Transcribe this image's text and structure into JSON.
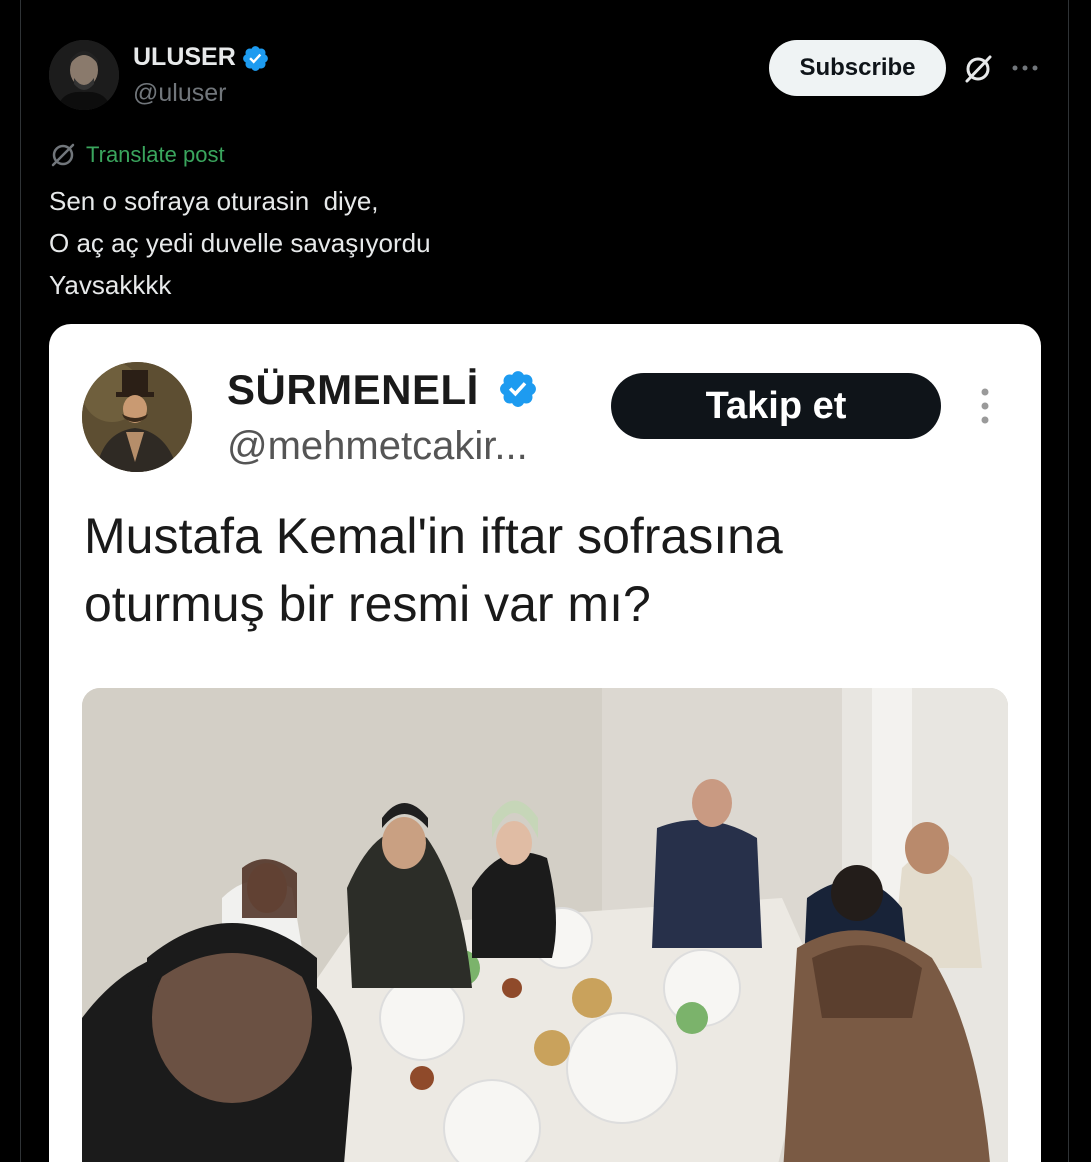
{
  "author": {
    "display_name": "ULUSER",
    "handle": "@uluser",
    "verified": true,
    "verified_color": "#1d9bf0"
  },
  "actions": {
    "subscribe_label": "Subscribe",
    "grok_icon": "grok-icon",
    "more_icon": "more-icon"
  },
  "translate": {
    "label": "Translate post",
    "icon": "grok-icon"
  },
  "post": {
    "lines": [
      "Sen o sofraya oturasin  diye,",
      "O aç aç yedi duvelle savaşıyordu",
      "Yavsakkkk"
    ]
  },
  "embedded": {
    "display_name": "SÜRMENELİ",
    "handle": "@mehmetcakir...",
    "follow_label": "Takip et",
    "lines": [
      "Mustafa Kemal'in iftar sofrasına",
      "oturmuş bir resmi var mı?"
    ]
  },
  "colors": {
    "background": "#000000",
    "text": "#e7e9ea",
    "muted": "#71767b",
    "accent": "#1d9bf0",
    "translate_green": "#3aa55d"
  }
}
